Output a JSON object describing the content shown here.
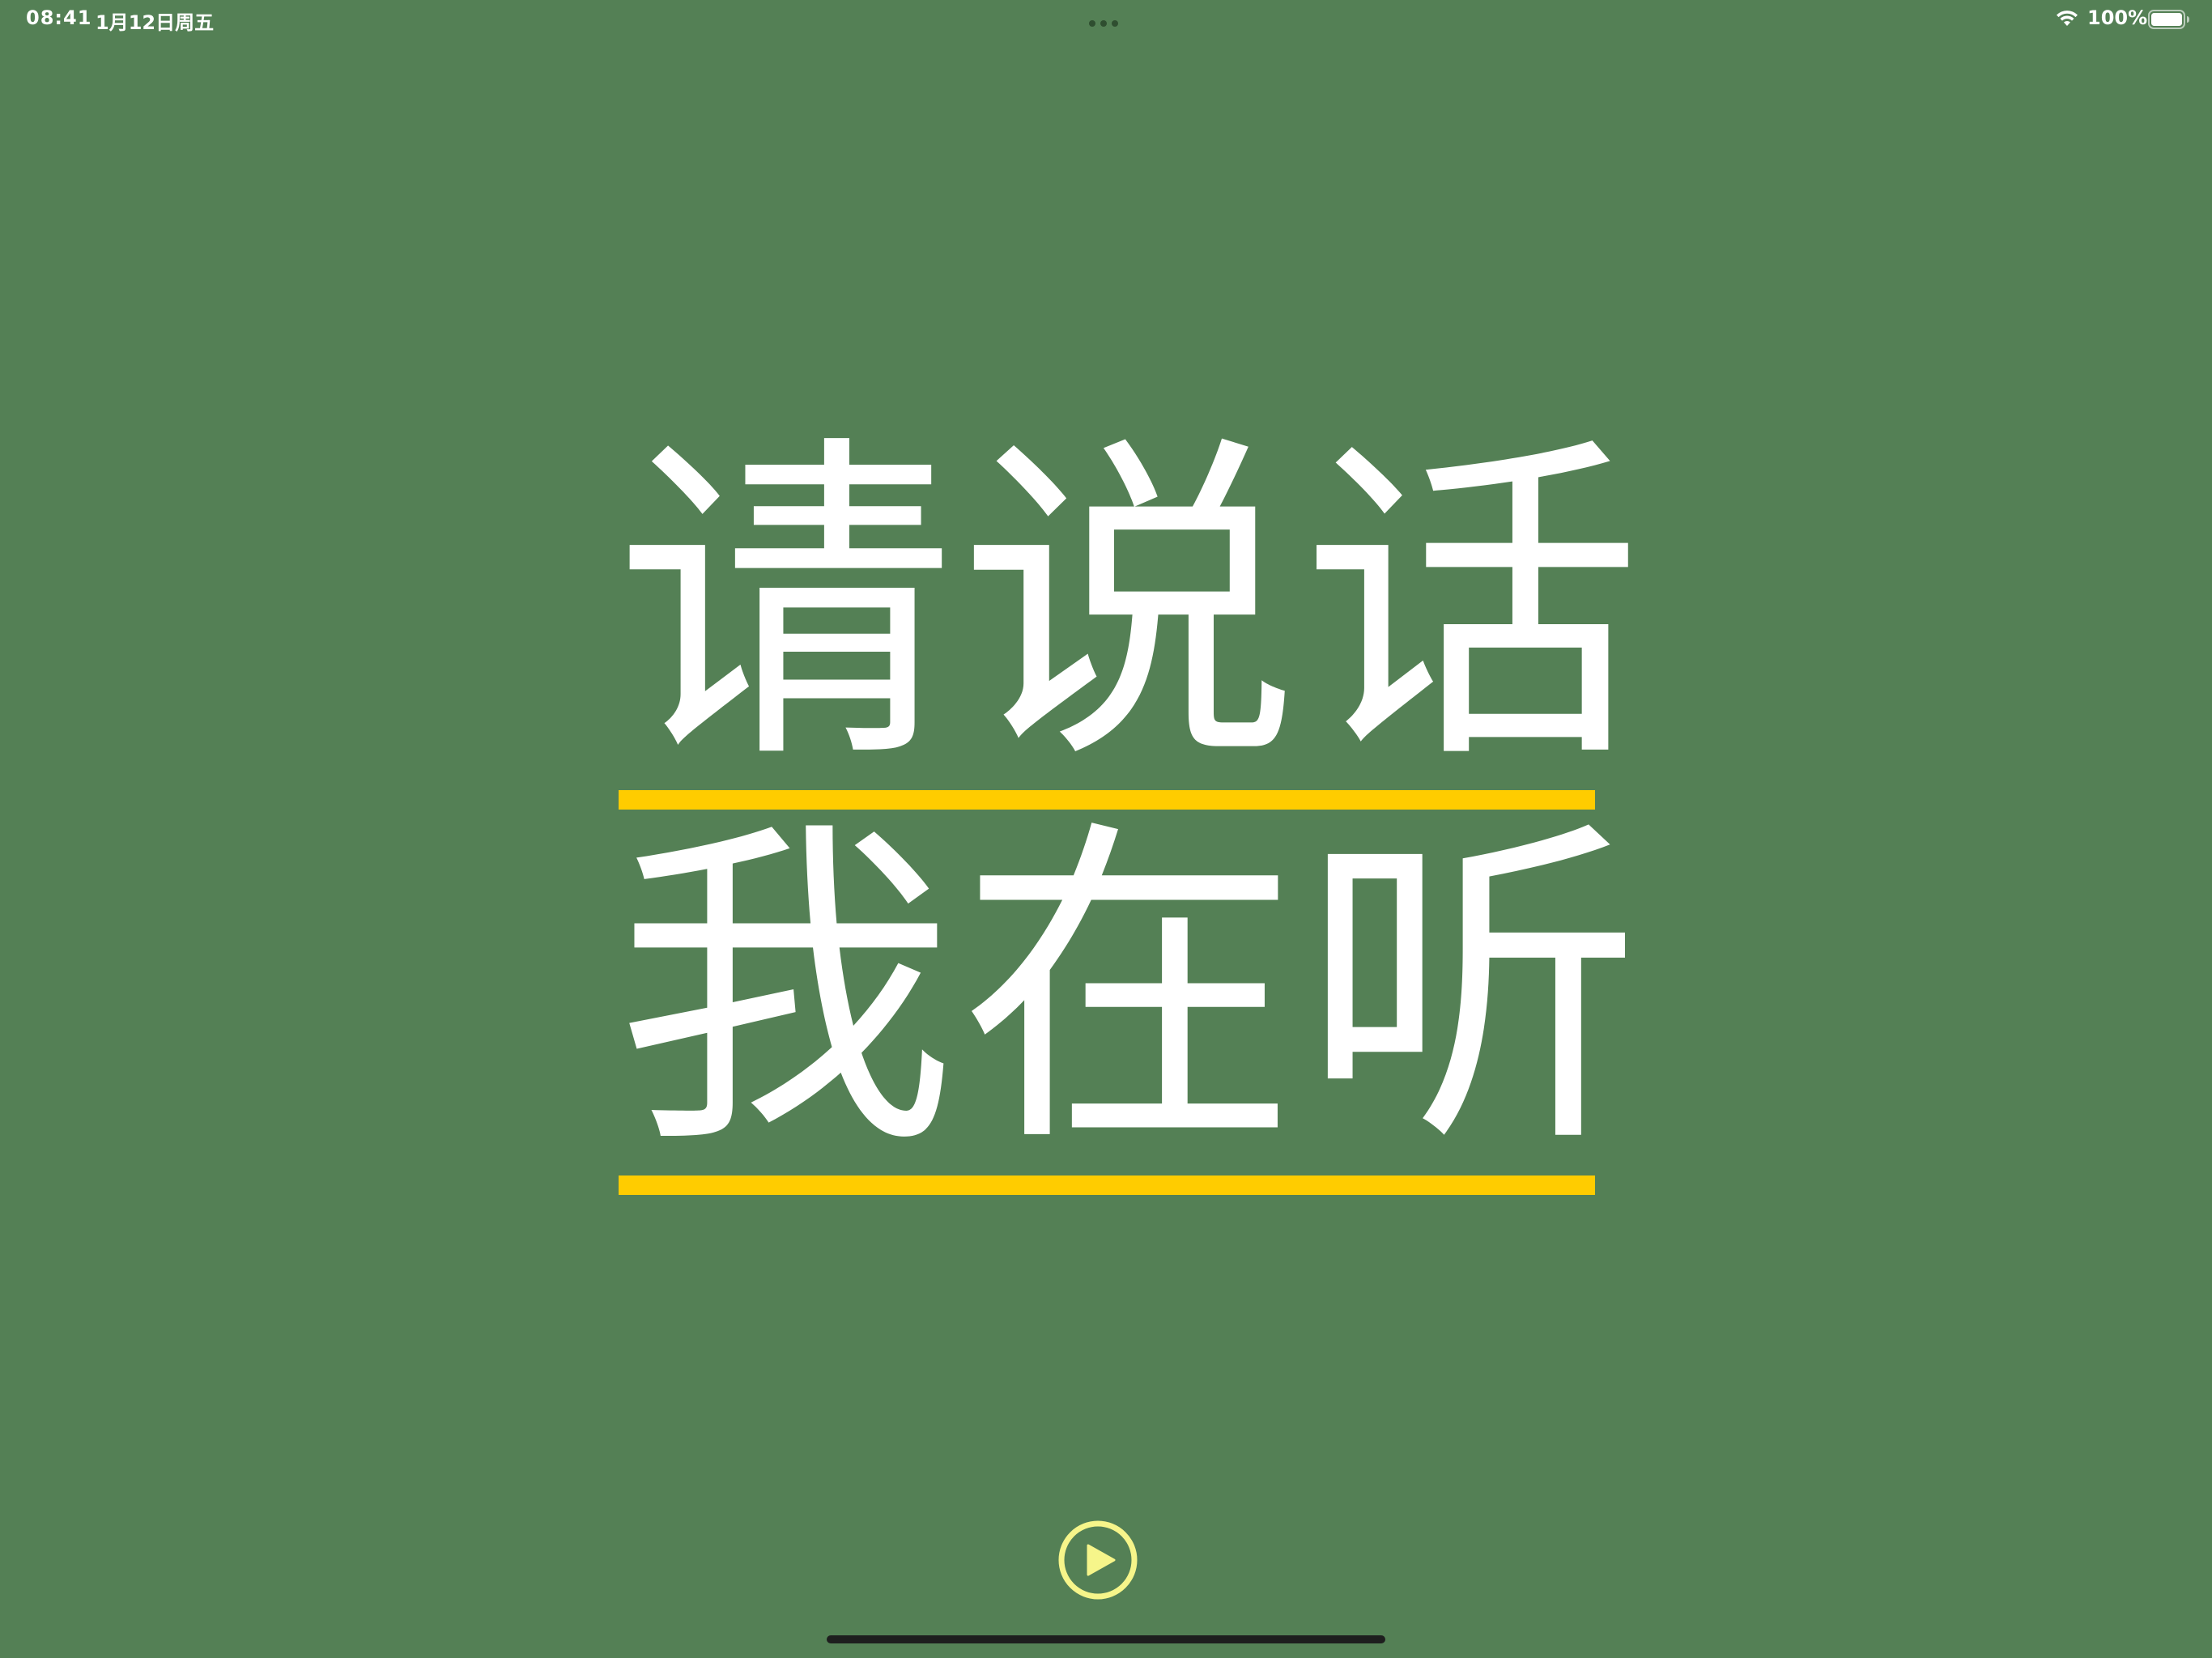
{
  "status_bar": {
    "time": "08:41",
    "date": "1月12日周五",
    "battery_percent": "100%",
    "battery_level": 1.0,
    "wifi_icon": "wifi-icon",
    "battery_icon": "battery-icon",
    "multitask_icon": "ellipsis-icon"
  },
  "main": {
    "line1": "请说话",
    "line2": "我在听"
  },
  "controls": {
    "play_icon": "play-circle-icon"
  },
  "colors": {
    "background": "#548055",
    "text": "#ffffff",
    "underline": "#ffcc00",
    "play_button": "#f6f58a"
  }
}
